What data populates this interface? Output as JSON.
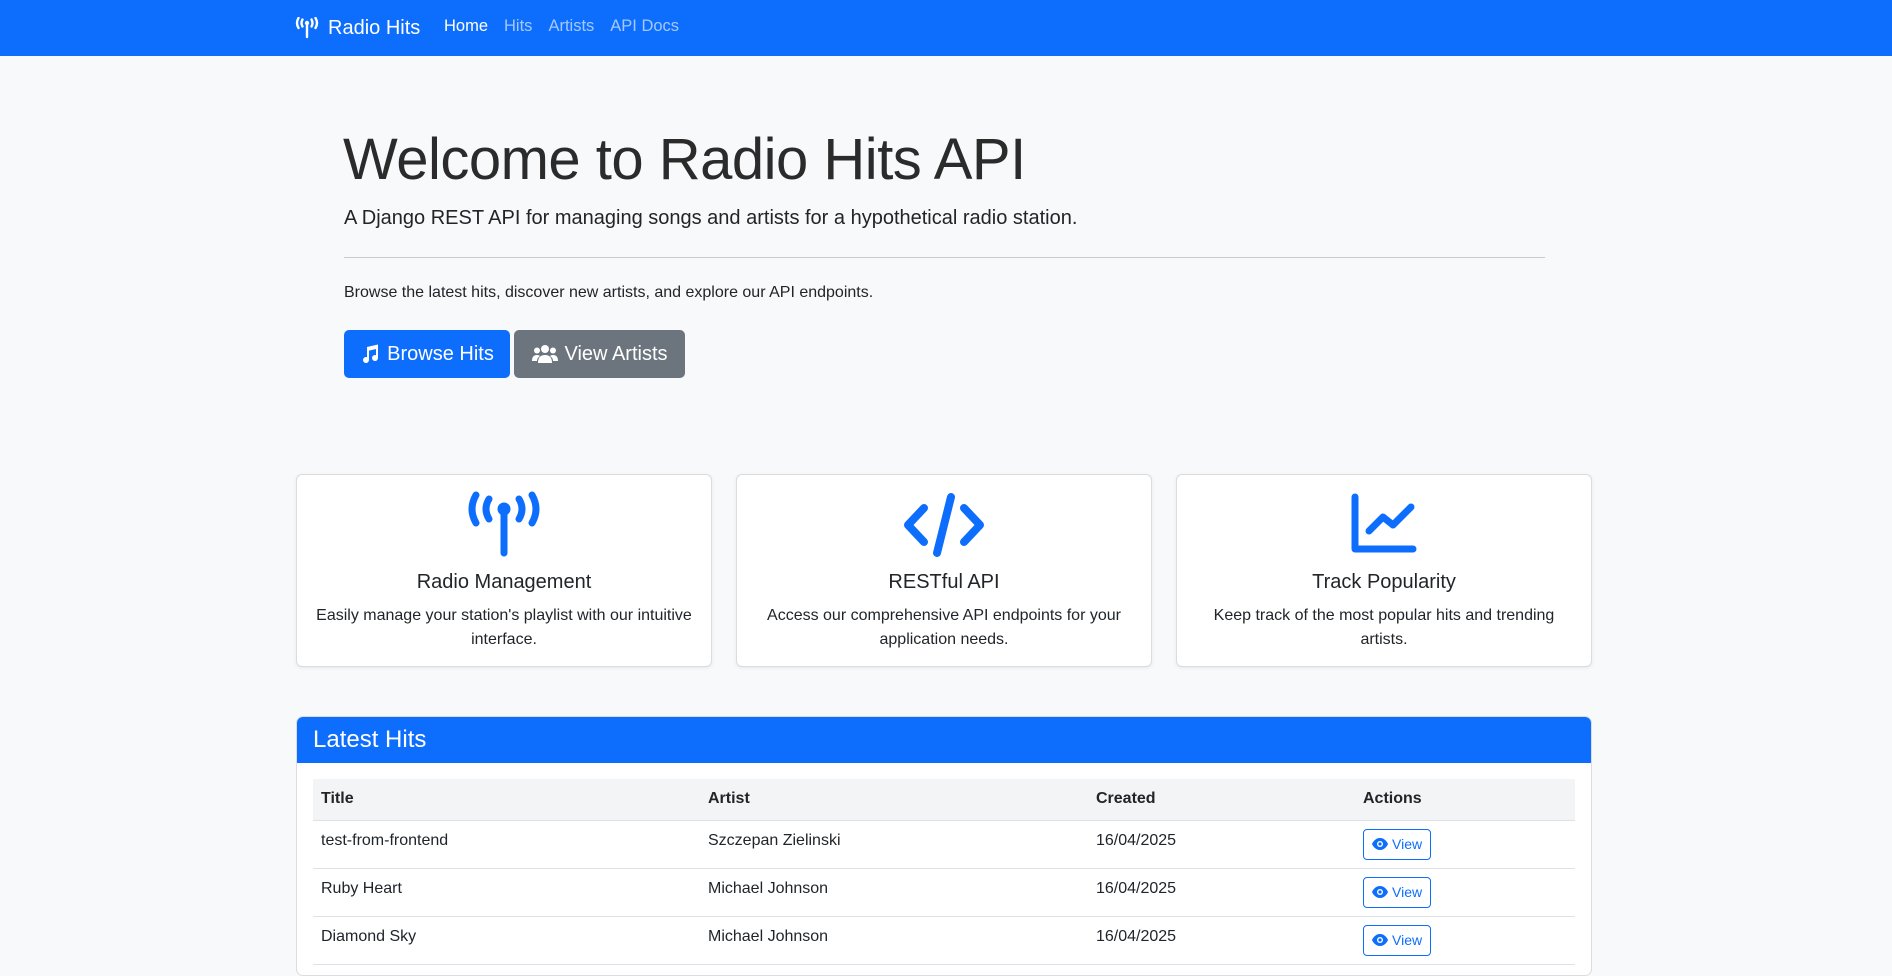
{
  "navbar": {
    "brand": "Radio Hits",
    "links": [
      {
        "label": "Home",
        "active": true
      },
      {
        "label": "Hits",
        "active": false
      },
      {
        "label": "Artists",
        "active": false
      },
      {
        "label": "API Docs",
        "active": false
      }
    ]
  },
  "hero": {
    "title": "Welcome to Radio Hits API",
    "lead": "A Django REST API for managing songs and artists for a hypothetical radio station.",
    "text": "Browse the latest hits, discover new artists, and explore our API endpoints.",
    "browse_button": "Browse Hits",
    "artists_button": "View Artists"
  },
  "features": [
    {
      "icon": "broadcast-tower-icon",
      "title": "Radio Management",
      "text": "Easily manage your station's playlist with our intuitive interface."
    },
    {
      "icon": "code-icon",
      "title": "RESTful API",
      "text": "Access our comprehensive API endpoints for your application needs."
    },
    {
      "icon": "chart-line-icon",
      "title": "Track Popularity",
      "text": "Keep track of the most popular hits and trending artists."
    }
  ],
  "latest_hits": {
    "header": "Latest Hits",
    "columns": [
      "Title",
      "Artist",
      "Created",
      "Actions"
    ],
    "rows": [
      {
        "title": "test-from-frontend",
        "artist": "Szczepan Zielinski",
        "created": "16/04/2025",
        "action": "View"
      },
      {
        "title": "Ruby Heart",
        "artist": "Michael Johnson",
        "created": "16/04/2025",
        "action": "View"
      },
      {
        "title": "Diamond Sky",
        "artist": "Michael Johnson",
        "created": "16/04/2025",
        "action": "View"
      }
    ]
  },
  "colors": {
    "primary": "#0d6efd",
    "secondary": "#6c757d",
    "background": "#f8f9fa"
  }
}
